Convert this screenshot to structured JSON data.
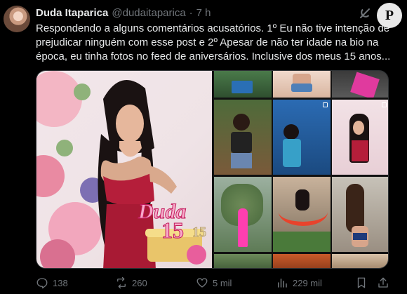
{
  "tweet": {
    "author_name": "Duda Itaparica",
    "author_handle": "@dudaitaparica",
    "separator": "·",
    "time": "7 h",
    "text": "Respondendo a alguns comentários acusatórios. 1º Eu não tive intenção de prejudicar ninguém com esse post e 2º Apesar de não ter idade na bio na época, eu tinha fotos no feed de aniversários. Inclusive dos meus 15 anos..."
  },
  "badge": {
    "letter": "P"
  },
  "header_icons": {
    "grok": "grok-icon",
    "more": "more-icon"
  },
  "media": {
    "main_photo_caption": "Duda",
    "main_photo_number": "15"
  },
  "actions": {
    "replies": "138",
    "reposts": "260",
    "likes": "5 mil",
    "views": "229 mil"
  },
  "colors": {
    "background": "#000000",
    "text": "#e7e9ea",
    "muted": "#71767b",
    "border": "#2f3336"
  }
}
